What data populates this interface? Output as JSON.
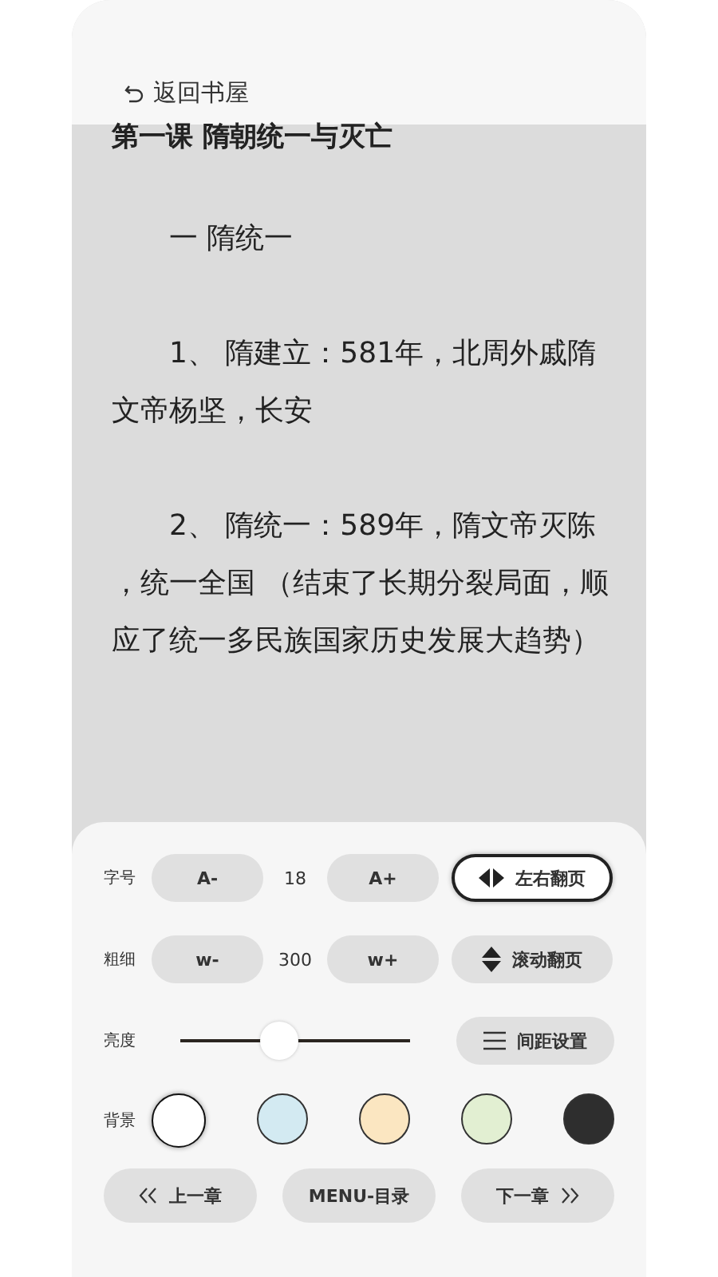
{
  "header": {
    "back_label": "返回书屋"
  },
  "chapter": {
    "title": "第一课 隋朝统一与灭亡",
    "paragraphs": [
      "一 隋统一",
      "1、 隋建立：581年，北周外戚隋文帝杨坚，长安",
      "2、 隋统一：589年，隋文帝灭陈，统一全国 （结束了长期分裂局面，顺应了统一多民族国家历史发展大趋势）"
    ]
  },
  "settings": {
    "adjust_rows": [
      {
        "label": "字号",
        "minus": "A-",
        "value": "18",
        "plus": "A+"
      },
      {
        "label": "粗细",
        "minus": "w-",
        "value": "300",
        "plus": "w+"
      }
    ],
    "page_modes": [
      {
        "kind": "horizontal",
        "label": "左右翻页",
        "selected": true
      },
      {
        "kind": "vertical",
        "label": "滚动翻页",
        "selected": false
      }
    ],
    "brightness": {
      "label": "亮度",
      "level": 0.43
    },
    "spacing_button": "间距设置",
    "background": {
      "label": "背景",
      "swatches": [
        {
          "color": "#ffffff",
          "selected": true
        },
        {
          "color": "#d3eaf2",
          "selected": false
        },
        {
          "color": "#fbe6c1",
          "selected": false
        },
        {
          "color": "#e2efd2",
          "selected": false
        },
        {
          "color": "#2e2e2e",
          "selected": false
        }
      ]
    },
    "nav": {
      "prev": "上一章",
      "menu": "MENU-目录",
      "next": "下一章"
    }
  }
}
